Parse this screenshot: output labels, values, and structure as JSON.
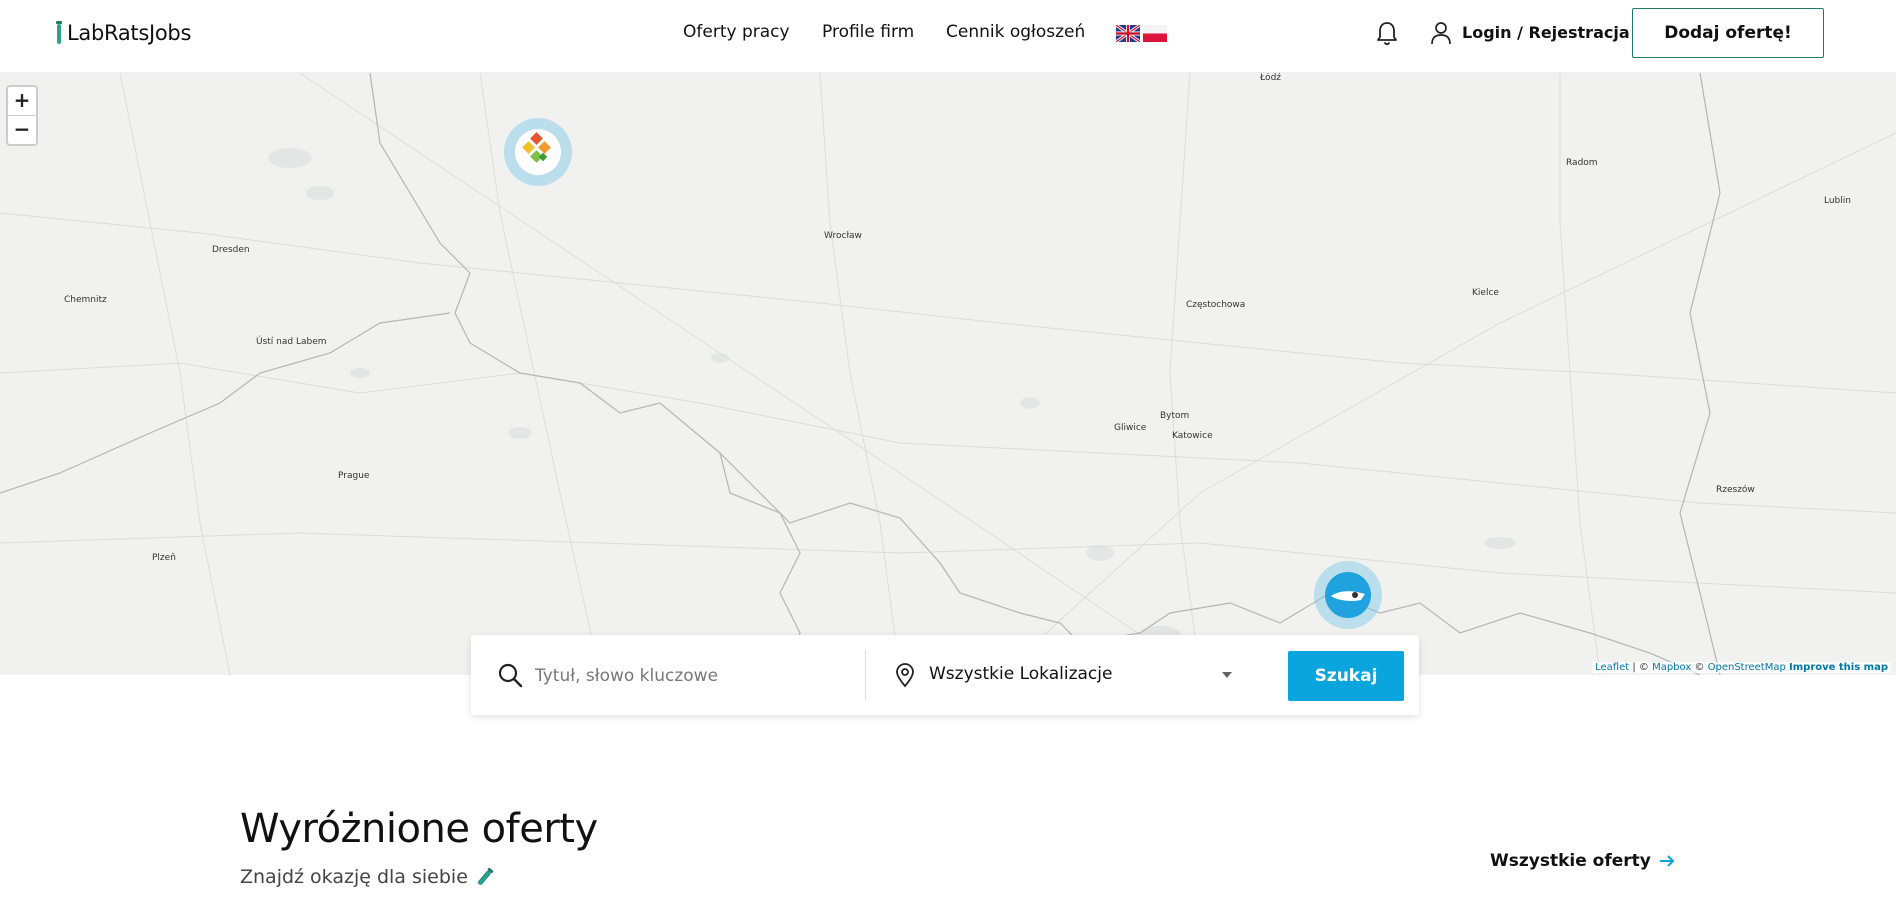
{
  "header": {
    "logo_text": "LabRatsJobs",
    "nav": [
      "Oferty pracy",
      "Profile firm",
      "Cennik ogłoszeń"
    ],
    "flags": [
      "uk-flag-icon",
      "pl-flag-icon"
    ],
    "login_label": "Login / Rejestracja",
    "add_offer_label": "Dodaj ofertę!",
    "accent_color": "#1e7a6a"
  },
  "map": {
    "zoom_in": "+",
    "zoom_out": "−",
    "cities_major": [
      "Wrocław",
      "Dresden",
      "Prague",
      "Kielce",
      "Częstochowa",
      "Radom",
      "Lublin",
      "Chemnitz",
      "Katowice",
      "Bytom",
      "Łódź",
      "Rzeszów",
      "Ústí nad Labem",
      "Plzeň",
      "Gliwice"
    ],
    "attribution": {
      "leaflet": "Leaflet",
      "sep1": " | © ",
      "mapbox": "Mapbox",
      "sep2": " © ",
      "osm": "OpenStreetMap",
      "improve": "Improve this map"
    },
    "markers": [
      "company-logo-marker",
      "company-logo-marker"
    ]
  },
  "search": {
    "placeholder": "Tytuł, słowo kluczowe",
    "location_value": "Wszystkie Lokalizacje",
    "button_label": "Szukaj",
    "button_color": "#0aa5dc"
  },
  "featured": {
    "title": "Wyróżnione oferty",
    "subtitle": "Znajdź okazję dla siebie",
    "all_offers_label": "Wszystkie oferty"
  }
}
